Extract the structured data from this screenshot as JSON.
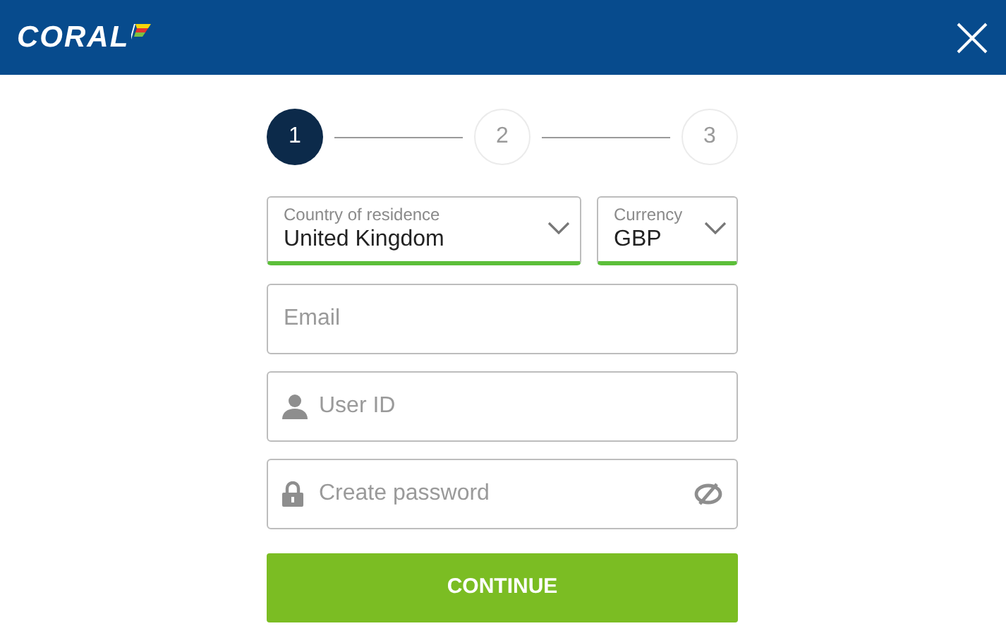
{
  "header": {
    "logo": "CORAL"
  },
  "steps": [
    {
      "label": "1",
      "selected": true
    },
    {
      "label": "2",
      "selected": false
    },
    {
      "label": "3",
      "selected": false
    }
  ],
  "selects": [
    {
      "label": "Country of residence",
      "value": "United Kingdom",
      "valid": true
    },
    {
      "label": "Currency",
      "value": "GBP",
      "valid": true
    }
  ],
  "fields": [
    {
      "placeholder": "Email",
      "kind": "plain"
    },
    {
      "placeholder": "User ID",
      "kind": "user"
    },
    {
      "placeholder": "Create password",
      "kind": "password"
    }
  ],
  "button": "CONTINUE"
}
